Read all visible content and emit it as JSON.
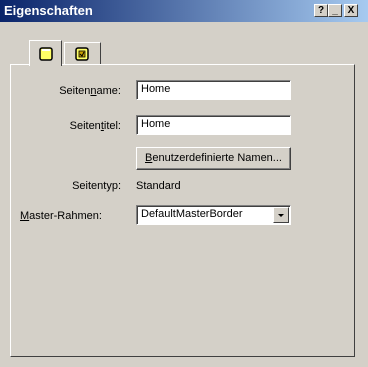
{
  "window": {
    "title": "Eigenschaften",
    "help_label": "?",
    "minimize_label": "_",
    "close_label": "X"
  },
  "tabs": [
    {
      "icon": "page-icon"
    },
    {
      "icon": "frame-icon"
    }
  ],
  "form": {
    "seitenname_pre": "Seiten",
    "seitenname_u": "n",
    "seitenname_post": "ame:",
    "seitenname_value": "Home",
    "seitentitel_pre": "Seiten",
    "seitentitel_u": "t",
    "seitentitel_post": "itel:",
    "seitentitel_value": "Home",
    "custom_names_u": "B",
    "custom_names_post": "enutzerdefinierte Namen...",
    "seitentyp_label": "Seitentyp:",
    "seitentyp_value": "Standard",
    "master_u": "M",
    "master_post": "aster-Rahmen:",
    "master_value": "DefaultMasterBorder"
  },
  "colors": {
    "titlebar_start": "#0a246a",
    "titlebar_end": "#a6caf0",
    "dialog_bg": "#d4d0c8"
  }
}
